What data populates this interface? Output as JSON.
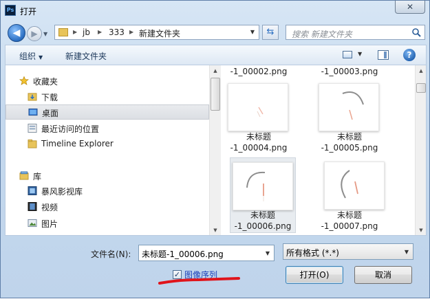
{
  "window": {
    "title": "打开",
    "app_icon": "Ps",
    "close_label": "✕"
  },
  "address": {
    "segments": [
      "jb",
      "333",
      "新建文件夹"
    ]
  },
  "search": {
    "placeholder": "搜索 新建文件夹"
  },
  "commandbar": {
    "organize": "组织",
    "new_folder": "新建文件夹"
  },
  "nav": {
    "items": [
      {
        "label": "收藏夹",
        "icon": "star-icon"
      },
      {
        "label": "下载",
        "icon": "download-folder-icon"
      },
      {
        "label": "桌面",
        "icon": "desktop-icon",
        "selected": true
      },
      {
        "label": "最近访问的位置",
        "icon": "recent-places-icon"
      },
      {
        "label": "Timeline Explorer",
        "icon": "folder-icon"
      },
      {
        "label": "库",
        "icon": "library-icon"
      },
      {
        "label": "暴风影视库",
        "icon": "video-library-icon"
      },
      {
        "label": "视频",
        "icon": "video-icon"
      },
      {
        "label": "图片",
        "icon": "pictures-icon"
      }
    ]
  },
  "files": {
    "top_partial": [
      "-1_00002.png",
      "-1_00003.png"
    ],
    "items": [
      {
        "name_line1": "未标题",
        "name_line2": "-1_00004.png",
        "stroke": "small"
      },
      {
        "name_line1": "未标题",
        "name_line2": "-1_00005.png",
        "stroke": "arc-top"
      },
      {
        "name_line1": "未标题",
        "name_line2": "-1_00006.png",
        "stroke": "arc-left",
        "selected": true
      },
      {
        "name_line1": "未标题",
        "name_line2": "-1_00007.png",
        "stroke": "arc-left-low"
      }
    ]
  },
  "bottom": {
    "filename_label": "文件名(N):",
    "filename_value": "未标题-1_00006.png",
    "filetype_value": "所有格式 (*.*)",
    "sequence_checkbox_label": "图像序列",
    "sequence_checked": true,
    "open_label": "打开(O)",
    "cancel_label": "取消"
  },
  "colors": {
    "accent": "#2b6fc2",
    "annotation": "#e0141b",
    "link_text": "#1a3fb8"
  }
}
